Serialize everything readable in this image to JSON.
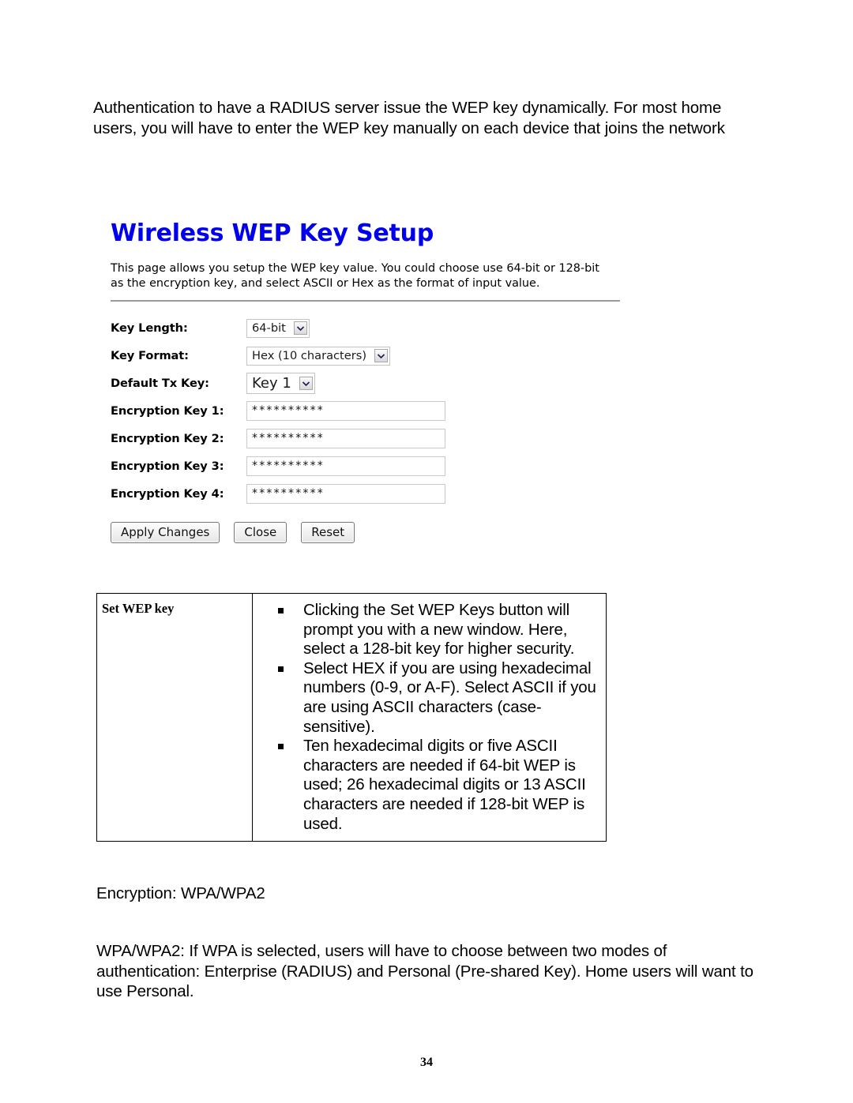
{
  "document": {
    "intro_paragraph": "Authentication to have a RADIUS server issue the WEP key dynamically. For most home users, you will have to enter the WEP key manually on each device that joins the network",
    "page_number": "34"
  },
  "panel": {
    "title": "Wireless WEP Key Setup",
    "description": "This page allows you setup the WEP key value. You could choose use 64-bit or 128-bit as the encryption key, and select ASCII or Hex as the format of input value.",
    "accent_color": "#0000ee",
    "fields": [
      {
        "label": "Key Length:",
        "type": "select",
        "value": "64-bit"
      },
      {
        "label": "Key Format:",
        "type": "select",
        "value": "Hex (10 characters)"
      },
      {
        "label": "Default Tx Key:",
        "type": "select",
        "value": "Key 1"
      },
      {
        "label": "Encryption Key 1:",
        "type": "text",
        "value": "**********"
      },
      {
        "label": "Encryption Key 2:",
        "type": "text",
        "value": "**********"
      },
      {
        "label": "Encryption Key 3:",
        "type": "text",
        "value": "**********"
      },
      {
        "label": "Encryption Key 4:",
        "type": "text",
        "value": "**********"
      }
    ],
    "buttons": [
      {
        "label": "Apply Changes"
      },
      {
        "label": "Close"
      },
      {
        "label": "Reset"
      }
    ]
  },
  "description_table": {
    "row_label": "Set WEP key",
    "bullets": [
      "Clicking the Set WEP Keys button will prompt you with a new window. Here, select a 128-bit key for higher security.",
      "Select HEX if you are using hexadecimal numbers (0-9, or A-F). Select ASCII if you are using ASCII characters (case-sensitive).",
      "Ten hexadecimal digits or five ASCII characters   are needed if 64-bit WEP is used; 26 hexadecimal digits or 13 ASCII characters are needed if 128-bit WEP is used."
    ]
  },
  "bottom": {
    "sub_heading": "Encryption: WPA/WPA2",
    "paragraph": "WPA/WPA2: If WPA is selected, users will have to choose between two modes of authentication: Enterprise (RADIUS) and Personal (Pre-shared Key). Home users will want to use Personal."
  }
}
